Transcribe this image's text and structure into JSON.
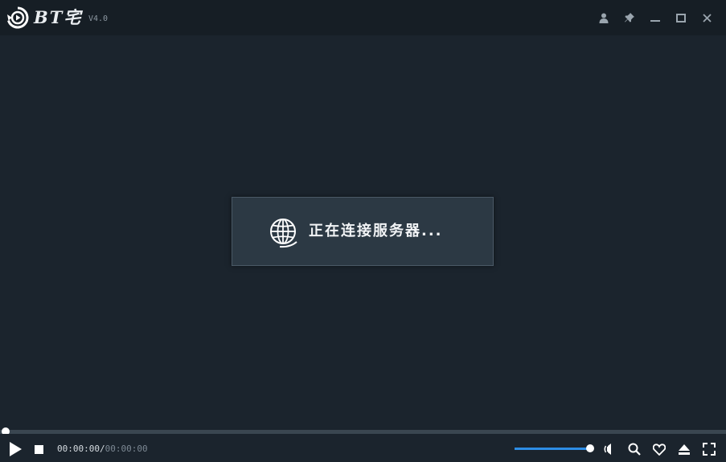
{
  "app": {
    "name": "BT宅",
    "version": "V4.0"
  },
  "titlebar": {
    "buttons": [
      {
        "name": "user-icon"
      },
      {
        "name": "pin-icon"
      },
      {
        "name": "minimize-icon"
      },
      {
        "name": "maximize-icon"
      },
      {
        "name": "close-icon"
      }
    ]
  },
  "dialog": {
    "icon": "globe-icon",
    "message": "正在连接服务器..."
  },
  "playback": {
    "progress": 0,
    "current_time": "00:00:00",
    "separator": "/",
    "total_time": "00:00:00"
  },
  "volume": {
    "level": 1.0
  },
  "controls": {
    "left": [
      "play-icon",
      "stop-icon"
    ],
    "right": [
      "volume-icon",
      "search-icon",
      "heart-icon",
      "eject-icon",
      "fullscreen-icon"
    ]
  },
  "colors": {
    "background": "#1b242d",
    "titlebar": "#161e25",
    "dialog": "#2c3944",
    "accent": "#2d8de5"
  }
}
